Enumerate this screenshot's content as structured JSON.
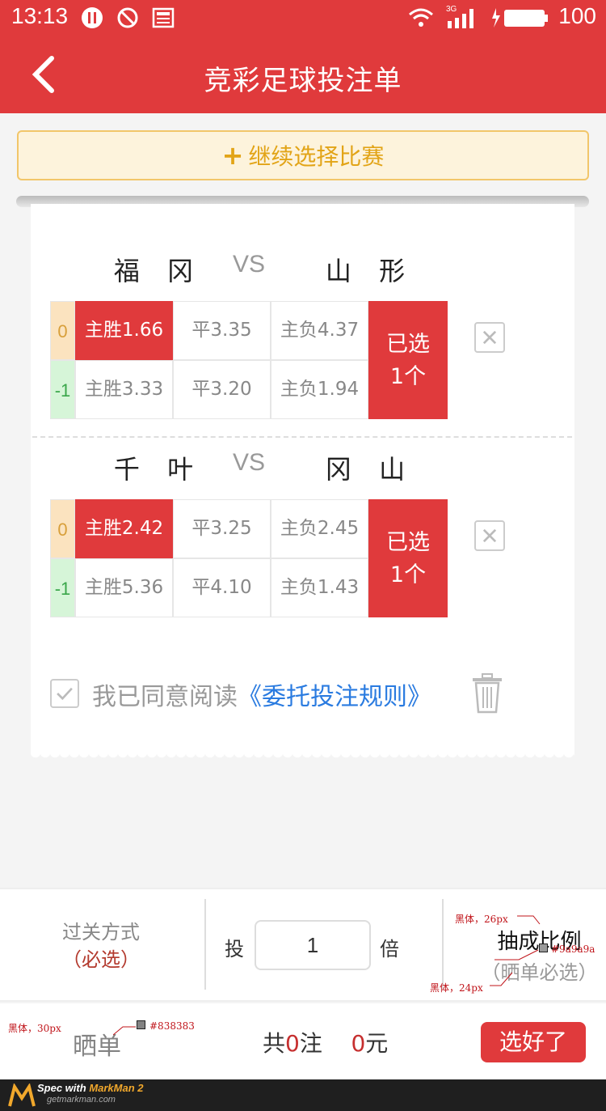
{
  "status_bar": {
    "time": "13:13",
    "network": "3G",
    "battery": "100"
  },
  "header": {
    "title": "竞彩足球投注单"
  },
  "continue_button": {
    "label": "继续选择比赛"
  },
  "matches": [
    {
      "home": "福 冈",
      "vs": "VS",
      "away": "山 形",
      "rows": [
        {
          "handicap": "0",
          "win": "主胜1.66",
          "draw": "平3.35",
          "lose": "主负4.37"
        },
        {
          "handicap": "-1",
          "win": "主胜3.33",
          "draw": "平3.20",
          "lose": "主负1.94"
        }
      ],
      "selected_line1": "已选",
      "selected_line2": "1个"
    },
    {
      "home": "千 叶",
      "vs": "VS",
      "away": "冈 山",
      "rows": [
        {
          "handicap": "0",
          "win": "主胜2.42",
          "draw": "平3.25",
          "lose": "主负2.45"
        },
        {
          "handicap": "-1",
          "win": "主胜5.36",
          "draw": "平4.10",
          "lose": "主负1.43"
        }
      ],
      "selected_line1": "已选",
      "selected_line2": "1个"
    }
  ],
  "agreement": {
    "text": "我已同意阅读",
    "link": "《委托投注规则》"
  },
  "pass_mode": {
    "label": "过关方式",
    "required": "（必选）"
  },
  "multiplier": {
    "prefix": "投",
    "value": "1",
    "suffix": "倍"
  },
  "ratio": {
    "label": "抽成比例",
    "sub": "（晒单必选）"
  },
  "footer": {
    "share": "晒单",
    "total_prefix": "共",
    "bets": "0",
    "bets_unit": "注",
    "amount": "0",
    "amount_unit": "元",
    "confirm": "选好了"
  },
  "annotations": {
    "a1": "黑体，26px",
    "a2": "#9a9a9a",
    "a3": "黑体，24px",
    "a4": "黑体，30px",
    "a5": "#838383"
  },
  "markman": {
    "spec": "Spec with",
    "name": "MarkMan 2",
    "site": "getmarkman.com"
  },
  "colors": {
    "brand_red": "#e03a3c",
    "gold": "#e2a417",
    "link_blue": "#2a7be0",
    "gray_text": "#9a9a9a",
    "share_gray": "#838383"
  }
}
